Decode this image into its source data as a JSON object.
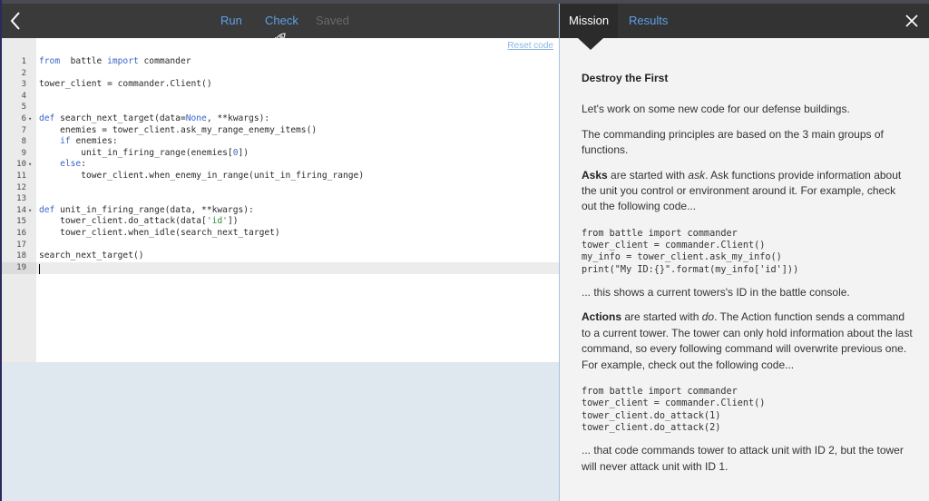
{
  "toolbar": {
    "run": "Run",
    "check": "Check",
    "saved": "Saved"
  },
  "editor": {
    "reset_label": "Reset code",
    "lines": [
      {
        "n": "1",
        "fold": "",
        "parts": [
          [
            "kw",
            "from"
          ],
          [
            "",
            "  battle "
          ],
          [
            "kw",
            "import"
          ],
          [
            "",
            " commander"
          ]
        ]
      },
      {
        "n": "2",
        "fold": "",
        "parts": []
      },
      {
        "n": "3",
        "fold": "",
        "parts": [
          [
            "",
            "tower_client = commander.Client()"
          ]
        ]
      },
      {
        "n": "4",
        "fold": "",
        "parts": []
      },
      {
        "n": "5",
        "fold": "",
        "parts": []
      },
      {
        "n": "6",
        "fold": "▾",
        "parts": [
          [
            "kw",
            "def"
          ],
          [
            "",
            " search_next_target(data="
          ],
          [
            "kw",
            "None"
          ],
          [
            "",
            ", **kwargs):"
          ]
        ]
      },
      {
        "n": "7",
        "fold": "",
        "parts": [
          [
            "",
            "    enemies = tower_client.ask_my_range_enemy_items()"
          ]
        ]
      },
      {
        "n": "8",
        "fold": "",
        "parts": [
          [
            "",
            "    "
          ],
          [
            "kw",
            "if"
          ],
          [
            "",
            " enemies:"
          ]
        ]
      },
      {
        "n": "9",
        "fold": "",
        "parts": [
          [
            "",
            "        unit_in_firing_range(enemies["
          ],
          [
            "num",
            "0"
          ],
          [
            "",
            "])"
          ]
        ]
      },
      {
        "n": "10",
        "fold": "▾",
        "parts": [
          [
            "",
            "    "
          ],
          [
            "kw",
            "else"
          ],
          [
            "",
            ":"
          ]
        ]
      },
      {
        "n": "11",
        "fold": "",
        "parts": [
          [
            "",
            "        tower_client.when_enemy_in_range(unit_in_firing_range)"
          ]
        ]
      },
      {
        "n": "12",
        "fold": "",
        "parts": []
      },
      {
        "n": "13",
        "fold": "",
        "parts": []
      },
      {
        "n": "14",
        "fold": "▾",
        "parts": [
          [
            "kw",
            "def"
          ],
          [
            "",
            " unit_in_firing_range(data, **kwargs):"
          ]
        ]
      },
      {
        "n": "15",
        "fold": "",
        "parts": [
          [
            "",
            "    tower_client.do_attack(data["
          ],
          [
            "str",
            "'id'"
          ],
          [
            "",
            "])"
          ]
        ]
      },
      {
        "n": "16",
        "fold": "",
        "parts": [
          [
            "",
            "    tower_client.when_idle(search_next_target)"
          ]
        ]
      },
      {
        "n": "17",
        "fold": "",
        "parts": []
      },
      {
        "n": "18",
        "fold": "",
        "parts": [
          [
            "",
            "search_next_target()"
          ]
        ]
      },
      {
        "n": "19",
        "fold": "",
        "parts": []
      }
    ]
  },
  "mission_panel": {
    "tabs": {
      "mission": "Mission",
      "results": "Results"
    },
    "title": "Destroy the First",
    "intro": "Let's work on some new code for our defense buildings.",
    "principles": "The commanding principles are based on the 3 main groups of functions.",
    "asks_term": "Asks",
    "asks_text_1": " are started with ",
    "asks_em": "ask",
    "asks_text_2": ". Ask functions provide information about the unit you control or environment around it. For example, check out the following code...",
    "asks_code": "from battle import commander\ntower_client = commander.Client()\nmy_info = tower_client.ask_my_info()\nprint(\"My ID:{}\".format(my_info['id']))",
    "asks_after": "... this shows a current towers's ID in the battle console.",
    "actions_term": "Actions",
    "actions_text_1": " are started with ",
    "actions_em": "do",
    "actions_text_2": ". The Action function sends a command to a current tower. The tower can only hold information about the last command, so every following command will overwrite previous one. For example, check out the following code...",
    "actions_code": "from battle import commander\ntower_client = commander.Client()\ntower_client.do_attack(1)\ntower_client.do_attack(2)",
    "actions_after": "... that code commands tower to attack unit with ID 2, but the tower will never attack unit with ID 1."
  },
  "colors": {
    "accent": "#5fa0e8",
    "bar": "#3a3a3a",
    "keyword": "#3a66c8"
  }
}
